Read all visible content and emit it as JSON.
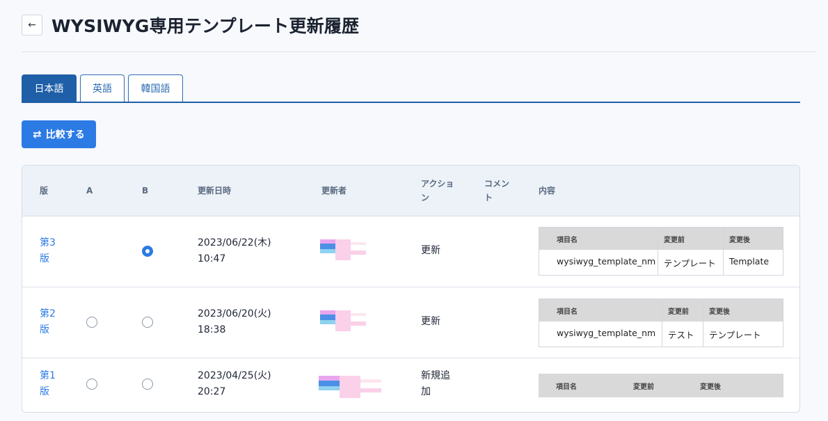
{
  "header": {
    "back_icon": "arrow-left-icon",
    "title": "WYSIWYG専用テンプレート更新履歴"
  },
  "tabs": [
    {
      "label": "日本語",
      "active": true
    },
    {
      "label": "英語",
      "active": false
    },
    {
      "label": "韓国語",
      "active": false
    }
  ],
  "compare_button": {
    "icon": "swap-arrows-icon",
    "label": "比較する"
  },
  "table": {
    "headers": {
      "version": "版",
      "a": "A",
      "b": "B",
      "updated_at": "更新日時",
      "updater": "更新者",
      "action_1": "アクショ",
      "action_2": "ン",
      "comment_1": "コメン",
      "comment_2": "ト",
      "content": "内容"
    },
    "rows": [
      {
        "version_1": "第3",
        "version_2": "版",
        "a_radio": "none",
        "b_radio": "checked",
        "date": "2023/06/22(木)",
        "time": "10:47",
        "action_1": "更新",
        "action_2": "",
        "diff": {
          "headers": [
            "項目名",
            "変更前",
            "変更後"
          ],
          "values": [
            "wysiwyg_template_nm",
            "テンプレート",
            "Template"
          ]
        }
      },
      {
        "version_1": "第2",
        "version_2": "版",
        "a_radio": "unchecked",
        "b_radio": "unchecked",
        "date": "2023/06/20(火)",
        "time": "18:38",
        "action_1": "更新",
        "action_2": "",
        "diff": {
          "headers": [
            "項目名",
            "変更前",
            "変更後"
          ],
          "values": [
            "wysiwyg_template_nm",
            "テスト",
            "テンプレート"
          ]
        }
      },
      {
        "version_1": "第1",
        "version_2": "版",
        "a_radio": "unchecked",
        "b_radio": "unchecked",
        "date": "2023/04/25(火)",
        "time": "20:27",
        "action_1": "新規追",
        "action_2": "加",
        "diff": {
          "headers": [
            "項目名",
            "変更前",
            "変更後"
          ],
          "values": []
        }
      }
    ]
  },
  "colors": {
    "primary": "#2c7be5",
    "tab_active": "#1f5fa8",
    "header_bg": "#edf2f8"
  }
}
